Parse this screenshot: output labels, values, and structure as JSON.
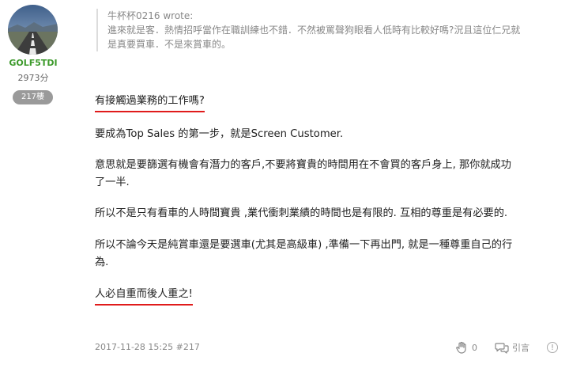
{
  "author": {
    "username": "GOLF5TDI",
    "score": "2973分",
    "floor": "217樓"
  },
  "quote": {
    "author_line": "牛杯杯0216 wrote:",
    "lines": [
      "進來就是客．熱情招呼當作在職訓練也不錯．不然被罵聲狗眼看人低時有比較好嗎?況且這位仁兄就",
      "是真要買車．不是來賞車的。"
    ]
  },
  "post": {
    "p1": "有接觸過業務的工作嗎?",
    "p2": "要成為Top Sales 的第一步，就是Screen Customer.",
    "p3_lines": [
      "意思就是要篩選有機會有潛力的客戶,不要將寶貴的時間用在不會買的客戶身上, 那你就成功",
      "了一半."
    ],
    "p4": "所以不是只有看車的人時間寶貴 ,業代衝刺業績的時間也是有限的. 互相的尊重是有必要的.",
    "p5_lines": [
      "所以不論今天是純賞車還是要選車(尤其是高級車) ,準備一下再出門, 就是一種尊重自己的行",
      "為."
    ],
    "p6": "人必自重而後人重之!"
  },
  "footer": {
    "timestamp": "2017-11-28 15:25 #217",
    "like_count": "0",
    "quote_label": "引言",
    "more_label": "!"
  },
  "colors": {
    "username": "#3c9a2b",
    "underline": "#e01b1b",
    "badge": "#9a9a9a"
  }
}
